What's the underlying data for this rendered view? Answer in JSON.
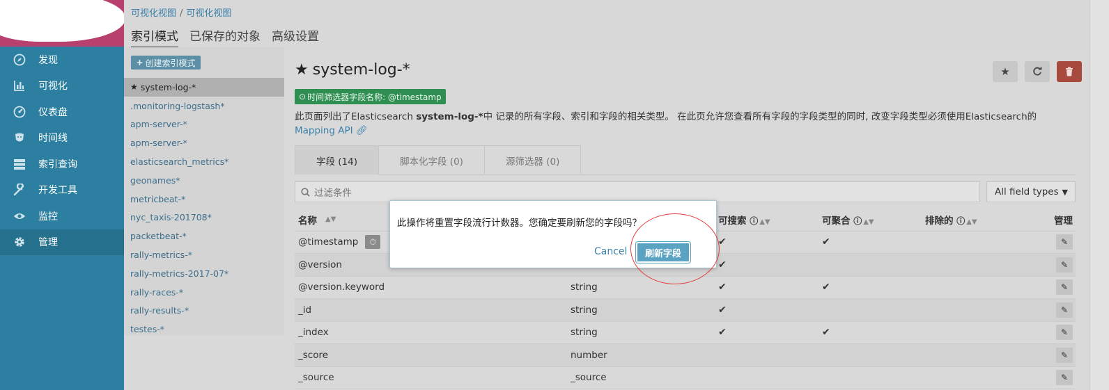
{
  "leftnav": {
    "items": [
      {
        "label": "发现",
        "icon": "compass-icon"
      },
      {
        "label": "可视化",
        "icon": "bar-chart-icon"
      },
      {
        "label": "仪表盘",
        "icon": "dashboard-icon"
      },
      {
        "label": "时间线",
        "icon": "timelion-icon"
      },
      {
        "label": "索引查询",
        "icon": "server-icon"
      },
      {
        "label": "开发工具",
        "icon": "wrench-icon"
      },
      {
        "label": "监控",
        "icon": "eye-icon"
      },
      {
        "label": "管理",
        "icon": "gear-icon"
      }
    ]
  },
  "breadcrumb": {
    "part1": "可视化视图",
    "separator": "/",
    "part2": "可视化视图"
  },
  "top_tabs": {
    "index_patterns": "索引模式",
    "saved_objects": "已保存的对象",
    "advanced": "高级设置"
  },
  "index_panel": {
    "create_label": "创建索引模式",
    "patterns": [
      "system-log-*",
      ".monitoring-logstash*",
      "apm-server-*",
      "apm-server-*",
      "elasticsearch_metrics*",
      "geonames*",
      "metricbeat-*",
      "nyc_taxis-201708*",
      "packetbeat-*",
      "rally-metrics-*",
      "rally-metrics-2017-07*",
      "rally-races-*",
      "rally-results-*",
      "testes-*"
    ]
  },
  "main": {
    "title": "system-log-*",
    "time_field_badge": "时间筛选器字段名称: @timestamp",
    "desc_part1": "此页面列出了Elasticsearch ",
    "desc_bold": "system-log-*",
    "desc_part2": "中 记录的所有字段、索引和字段的相关类型。 在此页允许您查看所有字段的字段类型的同时, 改变字段类型必须使用Elasticsearch的 ",
    "desc_link": "Mapping API",
    "tabs": {
      "fields": "字段 (14)",
      "scripted": "脚本化字段 (0)",
      "source_filters": "源筛选器 (0)"
    },
    "filter_placeholder": "过滤条件",
    "field_type_select": "All field types",
    "columns": {
      "name": "名称",
      "searchable": "可搜索",
      "aggregatable": "可聚合",
      "excluded": "排除的",
      "manage": "管理"
    },
    "rows": [
      {
        "name": "@timestamp",
        "type": "",
        "searchable": "✔",
        "aggregatable": "✔"
      },
      {
        "name": "@version",
        "type": "",
        "searchable": "✔",
        "aggregatable": ""
      },
      {
        "name": "@version.keyword",
        "type": "string",
        "searchable": "✔",
        "aggregatable": "✔"
      },
      {
        "name": "_id",
        "type": "string",
        "searchable": "✔",
        "aggregatable": ""
      },
      {
        "name": "_index",
        "type": "string",
        "searchable": "✔",
        "aggregatable": "✔"
      },
      {
        "name": "_score",
        "type": "number",
        "searchable": "",
        "aggregatable": ""
      },
      {
        "name": "_source",
        "type": "_source",
        "searchable": "",
        "aggregatable": ""
      }
    ]
  },
  "modal": {
    "message": "此操作将重置字段流行计数器。您确定要刷新您的字段吗？",
    "cancel_label": "Cancel",
    "confirm_label": "刷新字段"
  },
  "colors": {
    "nav_bg": "#2c7fa0",
    "brand_bg": "#b8406e",
    "success": "#2f8f52",
    "danger": "#a7493d",
    "primary": "#5aa3c3",
    "annotation": "#e23b3b"
  }
}
